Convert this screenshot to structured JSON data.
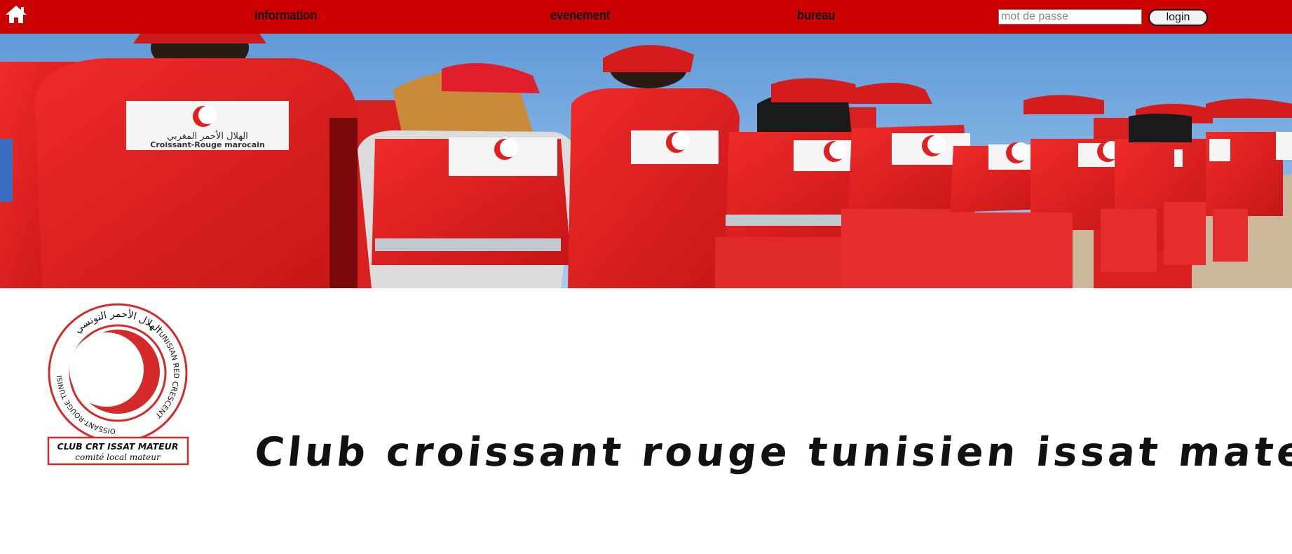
{
  "nav": {
    "home_icon": "home-icon",
    "links": [
      "information",
      "evenement",
      "bureau"
    ],
    "password_placeholder": "mot de passe",
    "password_value": "",
    "login_label": "login"
  },
  "banner": {
    "vest_text_arabic": "الهلال الأحمر المغربي",
    "vest_text_latin": "Croissant-Rouge marocain"
  },
  "logo": {
    "ring_arabic": "الهلال الأحمر التونسي",
    "ring_english": "TUNISIAN RED CRESCENT",
    "ring_french": "CROISSANT-ROUGE TUNISIEN",
    "club_name": "CLUB CRT ISSAT MATEUR",
    "committee": "comité local mateur"
  },
  "main": {
    "title": "Club croissant rouge tunisien issat mateur"
  },
  "colors": {
    "nav_bg": "#cc0000",
    "brand_red": "#d42a2a",
    "sky": "#6ea6dc"
  }
}
